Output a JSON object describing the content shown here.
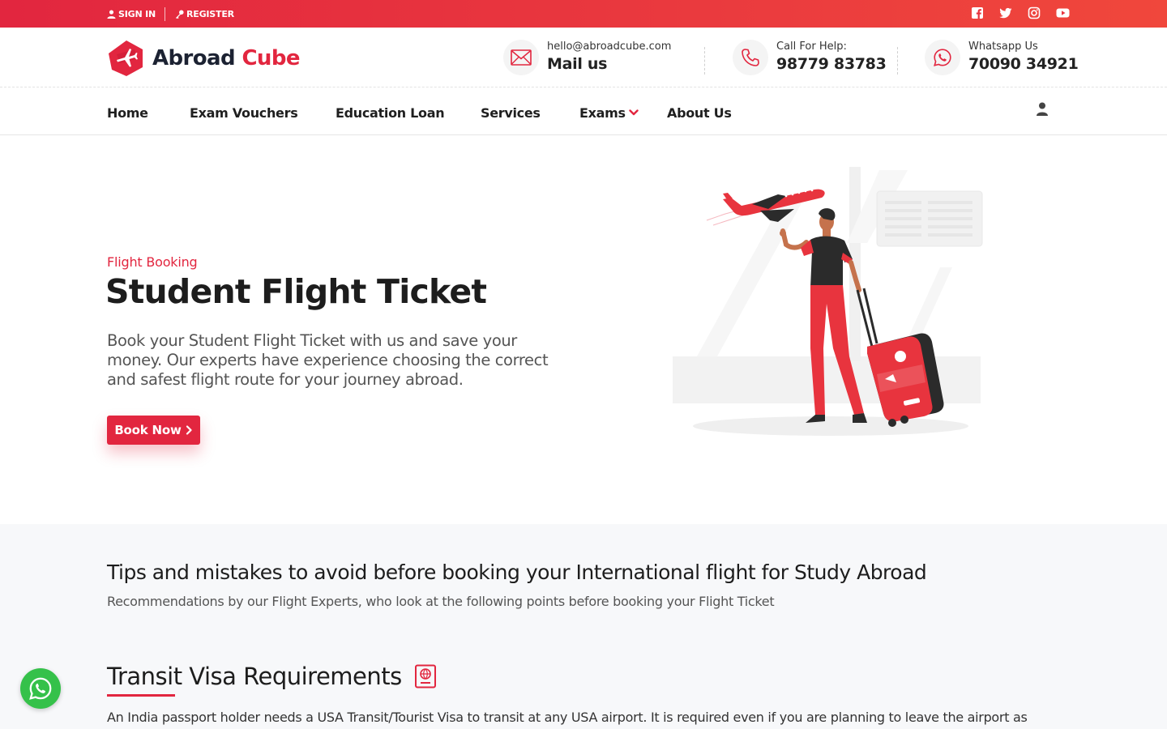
{
  "topbar": {
    "sign_in": "SIGN IN",
    "register": "REGISTER",
    "social": [
      "facebook-icon",
      "twitter-icon",
      "instagram-icon",
      "youtube-icon"
    ]
  },
  "brand": {
    "name_part1": "Abroad",
    "name_part2": "Cube",
    "accent": "#e2263f",
    "dark": "#1c2232"
  },
  "contacts": {
    "mail": {
      "small": "hello@abroadcube.com",
      "big": "Mail us",
      "icon": "mail-icon"
    },
    "call": {
      "small": "Call For Help:",
      "big": "98779 83783",
      "icon": "phone-icon"
    },
    "whatsapp": {
      "small": "Whatsapp Us",
      "big": "70090 34921",
      "icon": "whatsapp-icon"
    }
  },
  "nav": {
    "home": "Home",
    "exam_vouchers": "Exam Vouchers",
    "education_loan": "Education Loan",
    "services": "Services",
    "exams": "Exams",
    "about_us": "About Us"
  },
  "hero": {
    "eyebrow": "Flight Booking",
    "title": "Student Flight Ticket",
    "description": "Book your Student Flight Ticket with us and save your money. Our experts have experience choosing the correct and safest flight route for your journey abroad.",
    "button": "Book Now"
  },
  "tips": {
    "title": "Tips and mistakes to avoid before booking your International flight for Study Abroad",
    "subtitle": "Recommendations by our Flight Experts, who look at the following points before booking your Flight Ticket"
  },
  "visa": {
    "title": "Transit Visa Requirements",
    "text": "An India passport holder needs a USA Transit/Tourist Visa to transit at any USA airport. It is required even if you are planning to leave the airport as"
  }
}
